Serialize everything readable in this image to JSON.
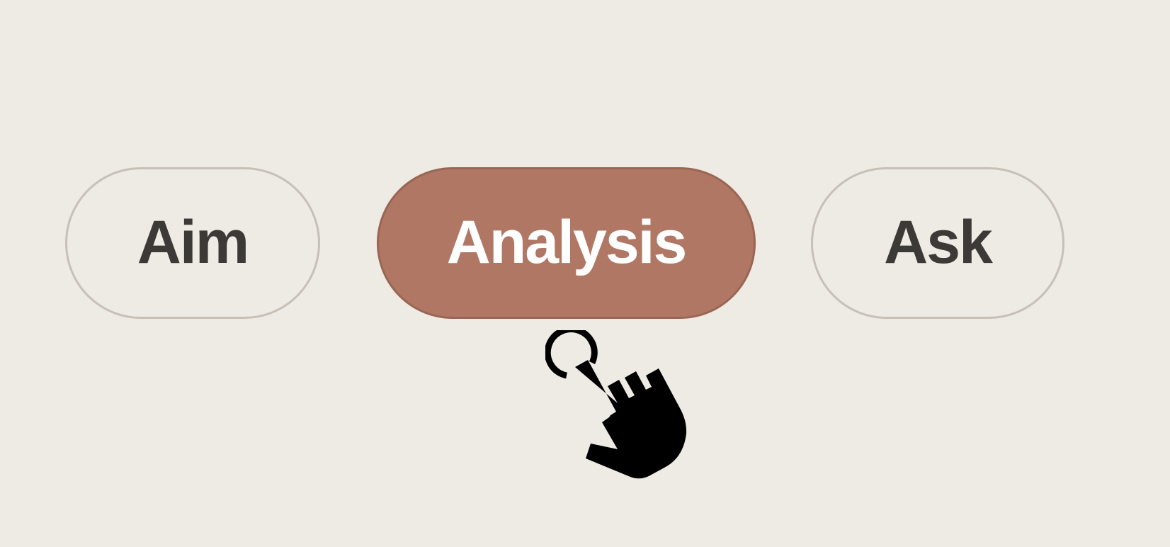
{
  "colors": {
    "background": "#eeeae4",
    "active_fill": "#b07864",
    "active_text": "#ffffff",
    "inactive_text": "#3b3a37",
    "cursor": "#000000"
  },
  "tabs": [
    {
      "label": "Aim",
      "selected": false
    },
    {
      "label": "Analysis",
      "selected": true
    },
    {
      "label": "Ask",
      "selected": false
    }
  ],
  "cursor": {
    "icon": "hand-pointer-click-icon"
  }
}
